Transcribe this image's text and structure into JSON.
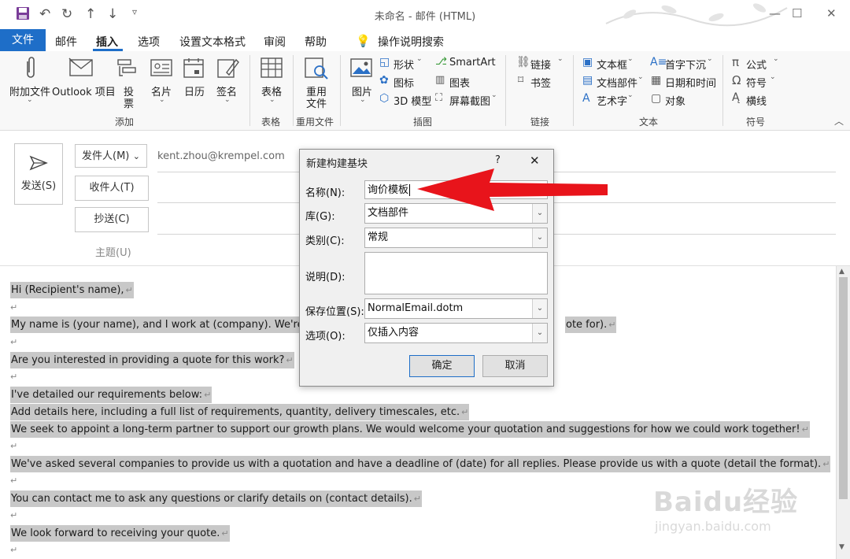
{
  "window": {
    "title": "未命名 - 邮件 (HTML)",
    "controls": {
      "minimize": "—",
      "maximize": "☐",
      "close": "✕"
    }
  },
  "tabs": [
    {
      "label": "文件"
    },
    {
      "label": "邮件"
    },
    {
      "label": "插入"
    },
    {
      "label": "选项"
    },
    {
      "label": "设置文本格式"
    },
    {
      "label": "审阅"
    },
    {
      "label": "帮助"
    },
    {
      "label": "操作说明搜索"
    }
  ],
  "ribbon": {
    "add_group": "添加",
    "attach_file": "附加文件",
    "outlook_item": "Outlook 项目",
    "vote_1": "投",
    "vote_2": "票",
    "business_card": "名片",
    "calendar": "日历",
    "signature": "签名",
    "tables_group": "表格",
    "table": "表格",
    "reuse_group": "重用文件",
    "reuse_1": "重用",
    "reuse_2": "文件",
    "illustrations_group": "插图",
    "picture": "图片",
    "shapes": "形状",
    "icons": "图标",
    "model3d": "3D 模型",
    "smartart": "SmartArt",
    "chart": "图表",
    "screenshot": "屏幕截图",
    "links_group": "链接",
    "link": "链接",
    "bookmark": "书签",
    "text_group": "文本",
    "textbox": "文本框",
    "quickparts": "文档部件",
    "wordart": "艺术字",
    "dropcap": "首字下沉",
    "datetime": "日期和时间",
    "object": "对象",
    "symbols_group": "符号",
    "equation": "公式",
    "symbol": "符号",
    "hline": "横线"
  },
  "compose": {
    "send": "发送(S)",
    "from": "发件人(M)",
    "from_email": "kent.zhou@krempel.com",
    "to": "收件人(T)",
    "cc": "抄送(C)",
    "subject": "主题(U)"
  },
  "body_lines": [
    "Hi (Recipient's name),",
    "My name is (your name), and I work at (company). We're looking",
    "ote for).",
    "Are you interested in providing a quote for this work?",
    "I've detailed our requirements below:",
    "Add details here, including a full list of requirements, quantity, delivery timescales, etc.",
    "We seek to appoint a long-term partner to support our growth plans. We would welcome your quotation and suggestions for how we could work together!",
    "We've asked several companies to provide us with a quotation and have a deadline of (date) for all replies. Please provide us with a quote (detail the format).",
    "You can contact me to ask any questions or clarify details on (contact details).",
    "We look forward to receiving your quote."
  ],
  "para_mark": "↵",
  "dialog": {
    "title": "新建构建基块",
    "help": "?",
    "close": "✕",
    "name_label": "名称(N):",
    "name_value": "询价模板",
    "gallery_label": "库(G):",
    "gallery_value": "文档部件",
    "category_label": "类别(C):",
    "category_value": "常规",
    "description_label": "说明(D):",
    "save_label": "保存位置(S):",
    "save_value": "NormalEmail.dotm",
    "options_label": "选项(O):",
    "options_value": "仅插入内容",
    "ok": "确定",
    "cancel": "取消"
  },
  "watermark": {
    "brand": "Baidu经验",
    "url": "jingyan.baidu.com"
  },
  "colors": {
    "accent": "#1e6ec8",
    "arrow": "#e8141b",
    "selection": "#c8c8c8"
  }
}
